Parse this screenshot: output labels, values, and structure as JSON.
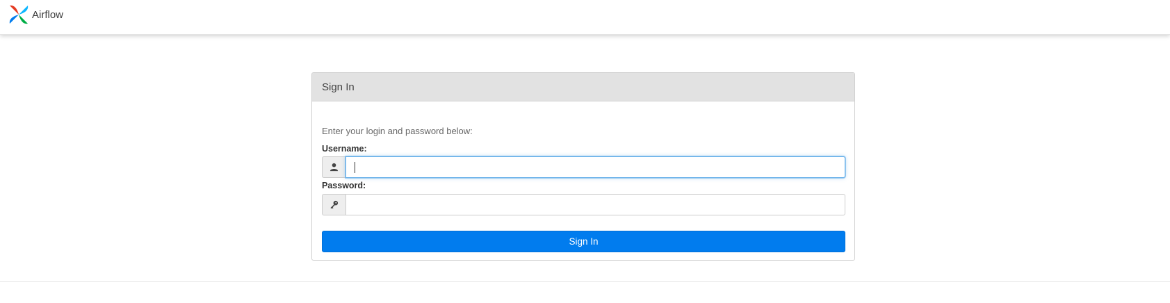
{
  "navbar": {
    "brand_label": "Airflow",
    "logo_icon": "airflow-pinwheel-logo"
  },
  "signin_panel": {
    "heading": "Sign In",
    "hint": "Enter your login and password below:",
    "username": {
      "label": "Username:",
      "value": "",
      "icon": "user-icon"
    },
    "password": {
      "label": "Password:",
      "value": "",
      "icon": "key-icon"
    },
    "submit_label": "Sign In"
  },
  "colors": {
    "primary_button": "#017cee",
    "panel_heading_bg": "#e2e2e2",
    "focus_border": "#66afe9",
    "logo_red": "#e43921",
    "logo_blue": "#0cb6ff",
    "logo_green": "#00ad46",
    "logo_navy": "#017cee"
  }
}
